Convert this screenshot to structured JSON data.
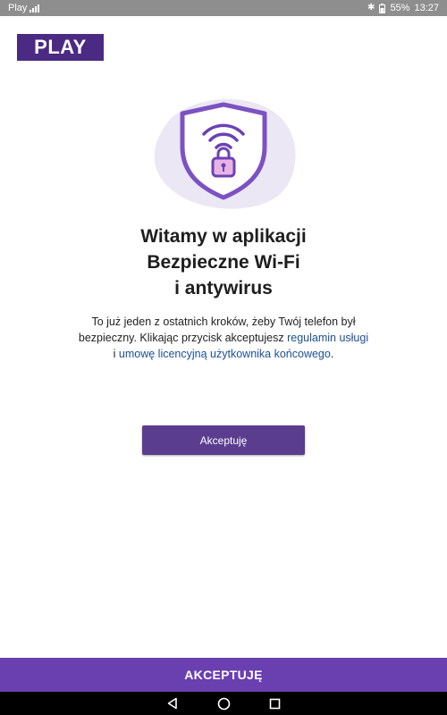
{
  "status_bar": {
    "carrier": "Play",
    "battery": "55%",
    "time": "13:27",
    "icons": [
      "signal-icon",
      "bluetooth-icon",
      "battery-icon"
    ]
  },
  "logo": {
    "text": "PLAY"
  },
  "hero": {
    "icon": "wifi-padlock-shield-icon"
  },
  "welcome": {
    "line1": "Witamy w aplikacji",
    "line2": "Bezpieczne Wi-Fi",
    "line3": "i antywirus"
  },
  "description": {
    "text1": "To już jeden z ostatnich kroków, żeby Twój telefon był",
    "text2": "bezpieczny. Klikając przycisk akceptujesz ",
    "link1": "regulamin usługi",
    "text3": "i ",
    "link2": "umowę licencyjną użytkownika końcowego",
    "text4": "."
  },
  "buttons": {
    "accept": "Akceptuję",
    "accept_bottom": "AKCEPTUJĘ"
  },
  "nav": [
    "back-icon",
    "home-icon",
    "recents-icon"
  ],
  "colors": {
    "brand": "#4b2a83",
    "button": "#5b3d8f",
    "bottom_bar": "#6a3fb0",
    "link": "#1d4f91"
  }
}
